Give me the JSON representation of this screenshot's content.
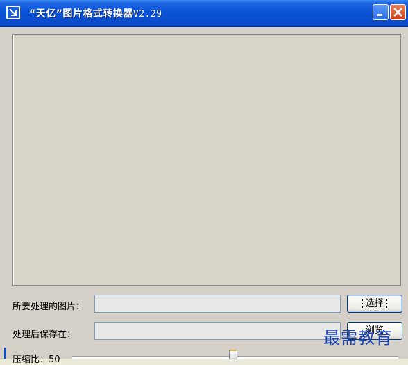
{
  "window": {
    "title": "“天亿”图片格式转换器",
    "version": "V2.29"
  },
  "form": {
    "source_label": "所要处理的图片：",
    "source_value": "",
    "source_button": "选择",
    "dest_label": "处理后保存在：",
    "dest_value": "",
    "dest_button": "浏览",
    "compression_label": "压缩比：",
    "compression_value": "50"
  },
  "watermark": "最需教育",
  "colors": {
    "titlebar": "#0a55d8",
    "window_bg": "#d4d0c8",
    "accent_close": "#c8401c"
  }
}
